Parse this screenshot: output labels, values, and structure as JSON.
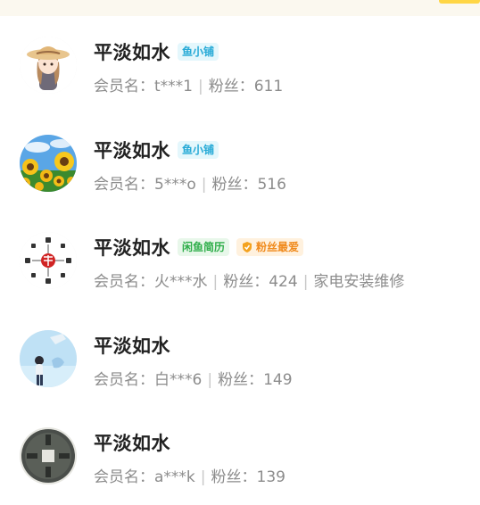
{
  "list": [
    {
      "avatar": "girl-straw-hat-avatar",
      "name": "平淡如水",
      "badges": [
        {
          "text": "鱼小铺",
          "style": "blue"
        }
      ],
      "member_label": "会员名：",
      "member_id": "t***1",
      "fans_label": "粉丝：",
      "fans": "611",
      "extra": ""
    },
    {
      "avatar": "sunflower-field-avatar",
      "name": "平淡如水",
      "badges": [
        {
          "text": "鱼小铺",
          "style": "blue"
        }
      ],
      "member_label": "会员名：",
      "member_id": "5***o",
      "fans_label": "粉丝：",
      "fans": "516",
      "extra": ""
    },
    {
      "avatar": "calligraphy-seal-avatar",
      "name": "平淡如水",
      "badges": [
        {
          "text": "闲鱼简历",
          "style": "green"
        },
        {
          "text": "粉丝最爱",
          "style": "orange",
          "icon": "shield-check-icon"
        }
      ],
      "member_label": "会员名：",
      "member_id": "火***水",
      "fans_label": "粉丝：",
      "fans": "424",
      "extra": "家电安装维修"
    },
    {
      "avatar": "anime-sky-avatar",
      "name": "平淡如水",
      "badges": [],
      "member_label": "会员名：",
      "member_id": "白***6",
      "fans_label": "粉丝：",
      "fans": "149",
      "extra": ""
    },
    {
      "avatar": "ancient-coin-avatar",
      "name": "平淡如水",
      "badges": [],
      "member_label": "会员名：",
      "member_id": "a***k",
      "fans_label": "粉丝：",
      "fans": "139",
      "extra": ""
    }
  ],
  "colors": {
    "top_accent": "#ffd645",
    "badge_blue": "#25a9d6",
    "badge_green": "#2fae4a",
    "badge_orange": "#f08a1c"
  }
}
